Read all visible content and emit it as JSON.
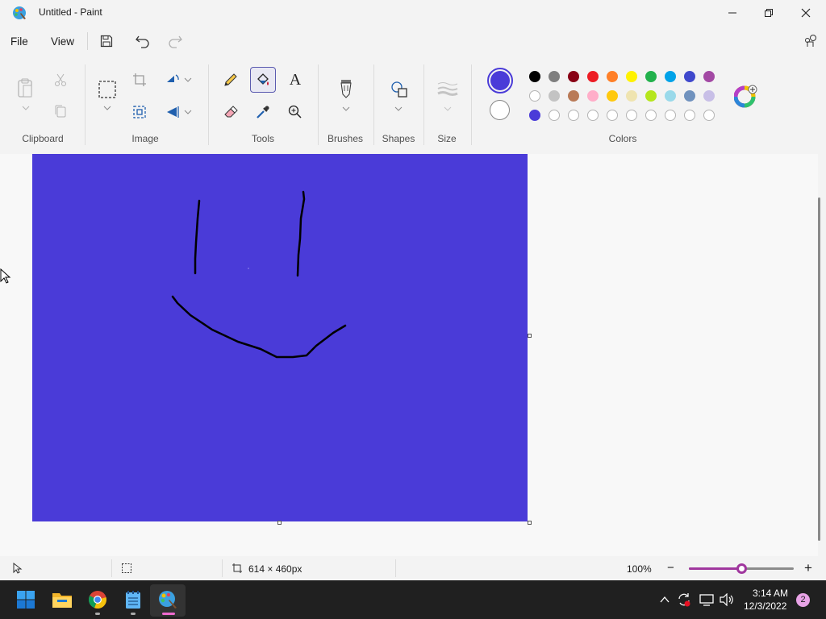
{
  "window": {
    "title": "Untitled - Paint"
  },
  "menu": {
    "file": "File",
    "view": "View"
  },
  "ribbon": {
    "groups": {
      "clipboard": "Clipboard",
      "image": "Image",
      "tools": "Tools",
      "brushes": "Brushes",
      "shapes": "Shapes",
      "size": "Size",
      "colors": "Colors"
    },
    "text_tool_glyph": "A"
  },
  "colors": {
    "primary": "#4a3bd8",
    "secondary": "#ffffff",
    "palette_row1": [
      "#000000",
      "#7f7f7f",
      "#880015",
      "#ed1c24",
      "#ff7f27",
      "#fff200",
      "#22b14c",
      "#00a2e8",
      "#3f48cc",
      "#a349a4"
    ],
    "palette_row2": [
      "#ffffff",
      "#c3c3c3",
      "#b97a57",
      "#ffaec9",
      "#ffc90e",
      "#efe4b0",
      "#b5e61d",
      "#99d9ea",
      "#7092be",
      "#c8bfe7"
    ],
    "palette_row3": [
      "#4a3bd8",
      "",
      "",
      "",
      "",
      "",
      "",
      "",
      "",
      ""
    ]
  },
  "canvas": {
    "background": "#4a3bd8",
    "stroke": "#000000"
  },
  "status": {
    "canvas_size": "614 × 460px",
    "zoom": "100%",
    "zoom_minus": "−",
    "zoom_plus": "+",
    "zoom_level": 0.5
  },
  "taskbar": {
    "time": "3:14 AM",
    "date": "12/3/2022",
    "notifications": "2"
  }
}
